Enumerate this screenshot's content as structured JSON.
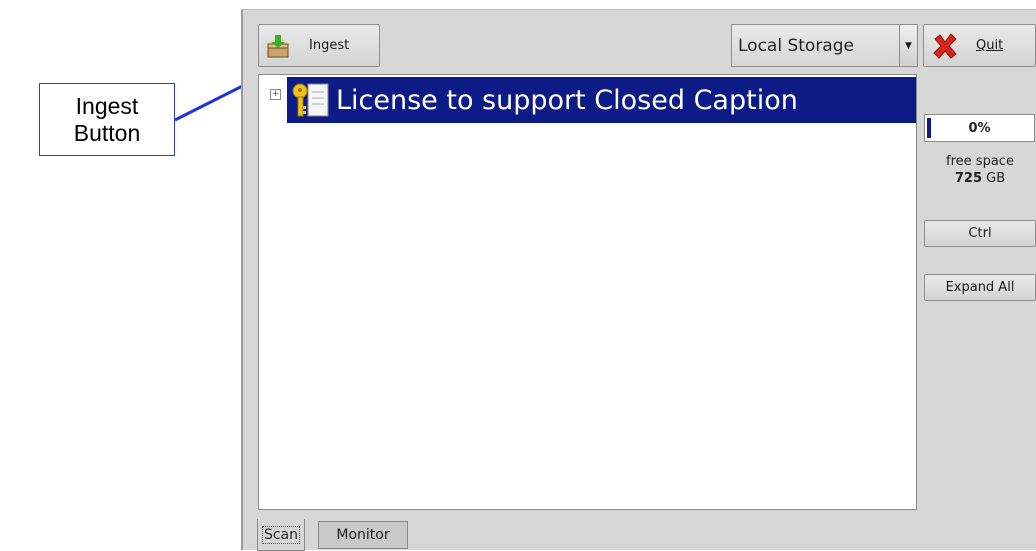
{
  "annotation": {
    "text": "Ingest\nButton"
  },
  "toolbar": {
    "ingest_label": "Ingest",
    "storage_value": "Local Storage",
    "quit_label": "Quit"
  },
  "tree": {
    "items": [
      {
        "label": "License to support Closed Caption",
        "expander": "+"
      }
    ]
  },
  "side_panel": {
    "progress_text": "0%",
    "progress_value": 0.0,
    "free_space_label": "free space",
    "free_space_value": "725",
    "free_space_unit": "GB",
    "ctrl_label": "Ctrl",
    "expand_all_label": "Expand All"
  },
  "tabs": [
    {
      "label": "Scan",
      "active": true
    },
    {
      "label": "Monitor",
      "active": false
    }
  ],
  "colors": {
    "selection": "#0c1b86",
    "annotation_border": "#2b3fd0",
    "window_bg": "#d7d7d7"
  },
  "icons": {
    "ingest": "ingest-box-icon",
    "quit": "red-x-icon",
    "tree_item": "key-license-icon",
    "dropdown": "dropdown-arrow-icon"
  }
}
